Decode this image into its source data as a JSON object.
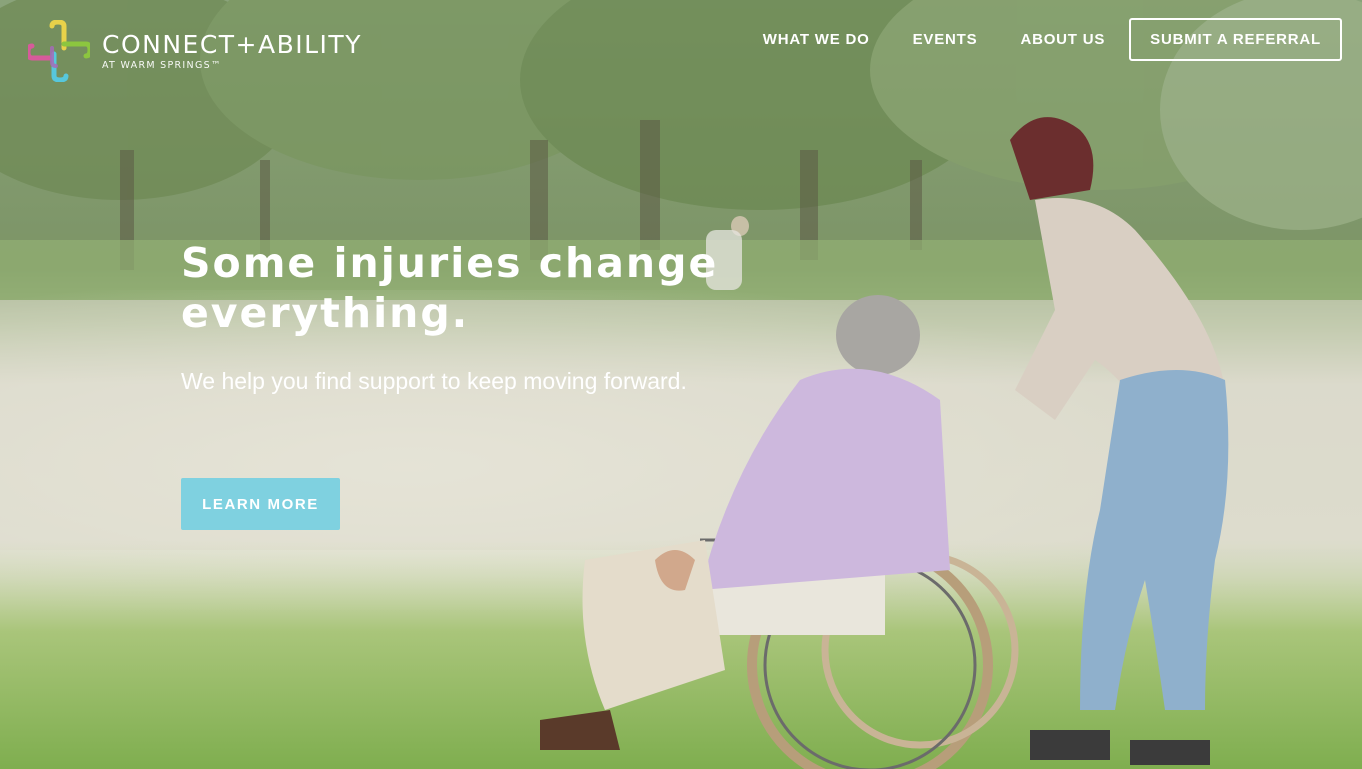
{
  "logo": {
    "name": "CONNECT+ABILITY",
    "tagline": "AT WARM SPRINGS™",
    "icon": "cross-logo-icon"
  },
  "nav": {
    "items": [
      {
        "label": "WHAT WE DO"
      },
      {
        "label": "EVENTS"
      },
      {
        "label": "ABOUT US"
      }
    ],
    "cta_label": "SUBMIT A REFERRAL"
  },
  "hero": {
    "headline": "Some injuries change everything.",
    "subheadline": "We help you find support to keep moving forward.",
    "button_label": "LEARN MORE",
    "image_description_icon": "park-wheelchair-photo"
  },
  "colors": {
    "accent": "#7fd1e0",
    "logo_yellow": "#e8d24a",
    "logo_pink": "#d65b9a",
    "logo_cyan": "#57c7dc",
    "logo_green": "#8cc63f"
  }
}
